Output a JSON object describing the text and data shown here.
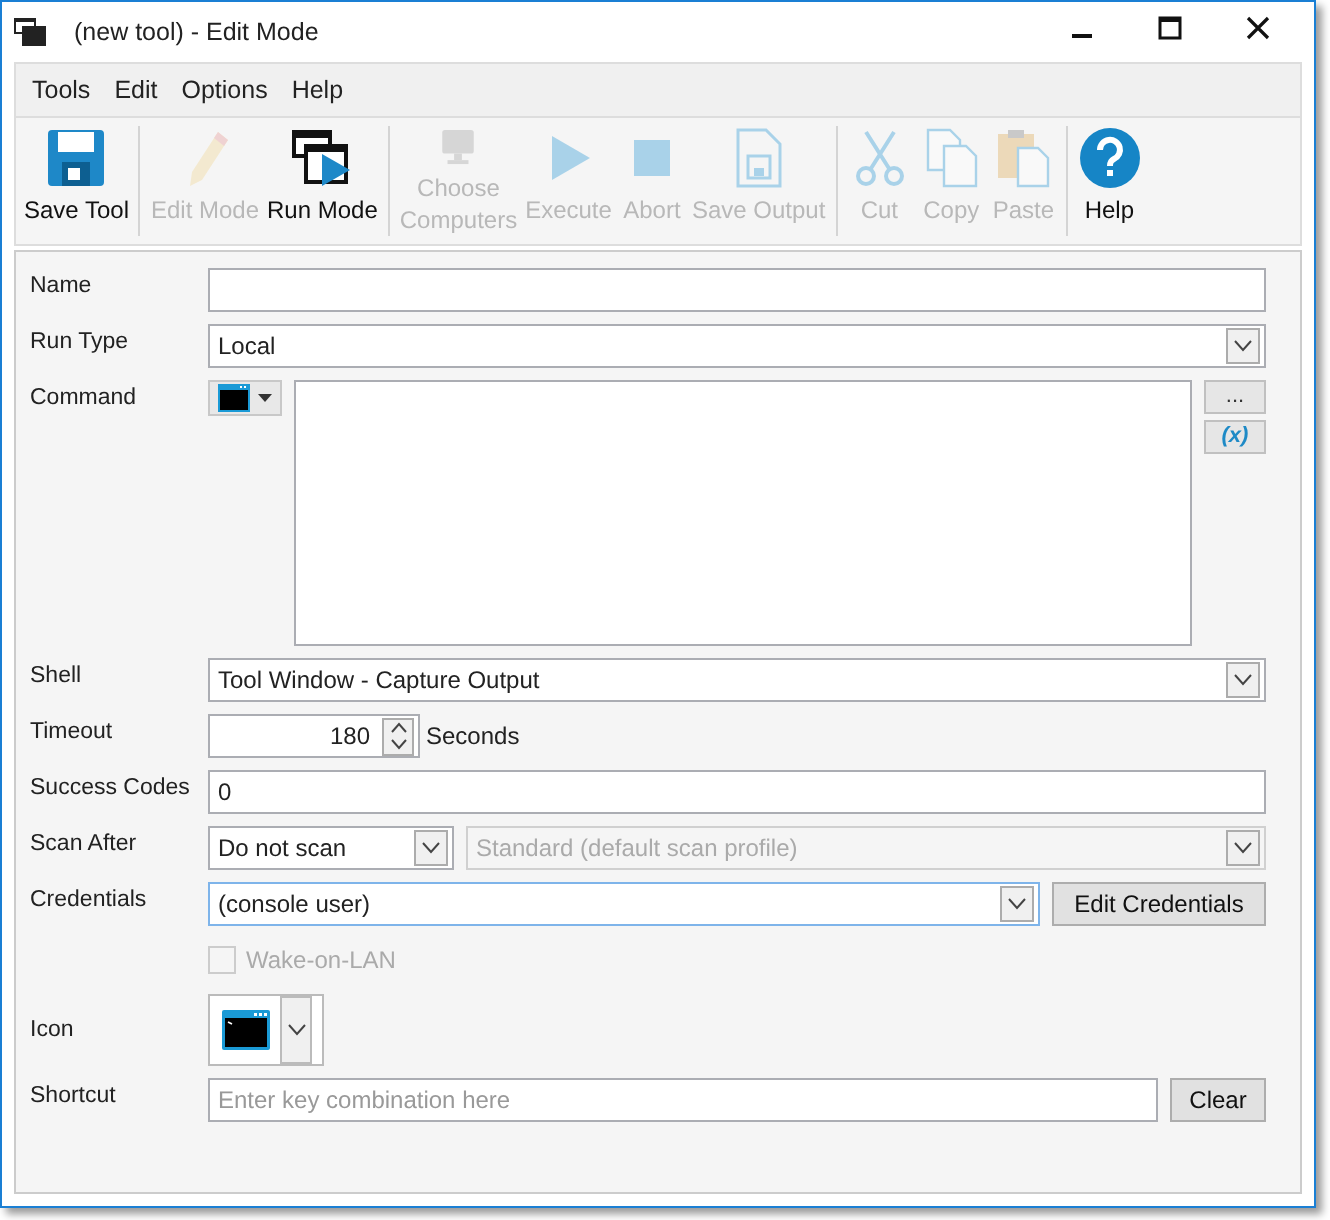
{
  "window": {
    "title": "(new tool) - Edit Mode"
  },
  "menu": [
    {
      "label": "Tools"
    },
    {
      "label": "Edit"
    },
    {
      "label": "Options"
    },
    {
      "label": "Help"
    }
  ],
  "toolbar": [
    [
      {
        "label": "Save Tool",
        "kind": "save",
        "disabled": false
      }
    ],
    [
      {
        "label": "Edit Mode",
        "kind": "edit",
        "disabled": true
      },
      {
        "label": "Run Mode",
        "kind": "run",
        "disabled": false
      }
    ],
    [
      {
        "label": "Choose\nComputers",
        "kind": "computers",
        "disabled": true
      },
      {
        "label": "Execute",
        "kind": "execute",
        "disabled": true
      },
      {
        "label": "Abort",
        "kind": "abort",
        "disabled": true
      },
      {
        "label": "Save Output",
        "kind": "output",
        "disabled": true
      }
    ],
    [
      {
        "label": "Cut",
        "kind": "cut",
        "disabled": true
      },
      {
        "label": "Copy",
        "kind": "copy",
        "disabled": true
      },
      {
        "label": "Paste",
        "kind": "paste",
        "disabled": true
      }
    ],
    [
      {
        "label": "Help",
        "kind": "help",
        "disabled": false
      }
    ]
  ],
  "form": {
    "name": {
      "label": "Name"
    },
    "run_type": {
      "label": "Run Type",
      "value": "Local"
    },
    "command": {
      "label": "Command",
      "browse": "...",
      "variable": "(x)"
    },
    "shell": {
      "label": "Shell",
      "value": "Tool Window - Capture Output"
    },
    "timeout": {
      "label": "Timeout",
      "value": "180",
      "unit": "Seconds"
    },
    "success_codes": {
      "label": "Success Codes",
      "value": "0"
    },
    "scan_after": {
      "label": "Scan After",
      "value": "Do not scan",
      "profile": {
        "value": "Standard (default scan profile)",
        "disabled": true
      }
    },
    "credentials": {
      "label": "Credentials",
      "value": "(console user)",
      "button": "Edit Credentials"
    },
    "wake_on_lan": {
      "label": "Wake-on-LAN",
      "checked": false,
      "disabled": true
    },
    "icon": {
      "label": "Icon"
    },
    "shortcut": {
      "label": "Shortcut",
      "placeholder": "Enter key combination here",
      "button": "Clear"
    }
  }
}
